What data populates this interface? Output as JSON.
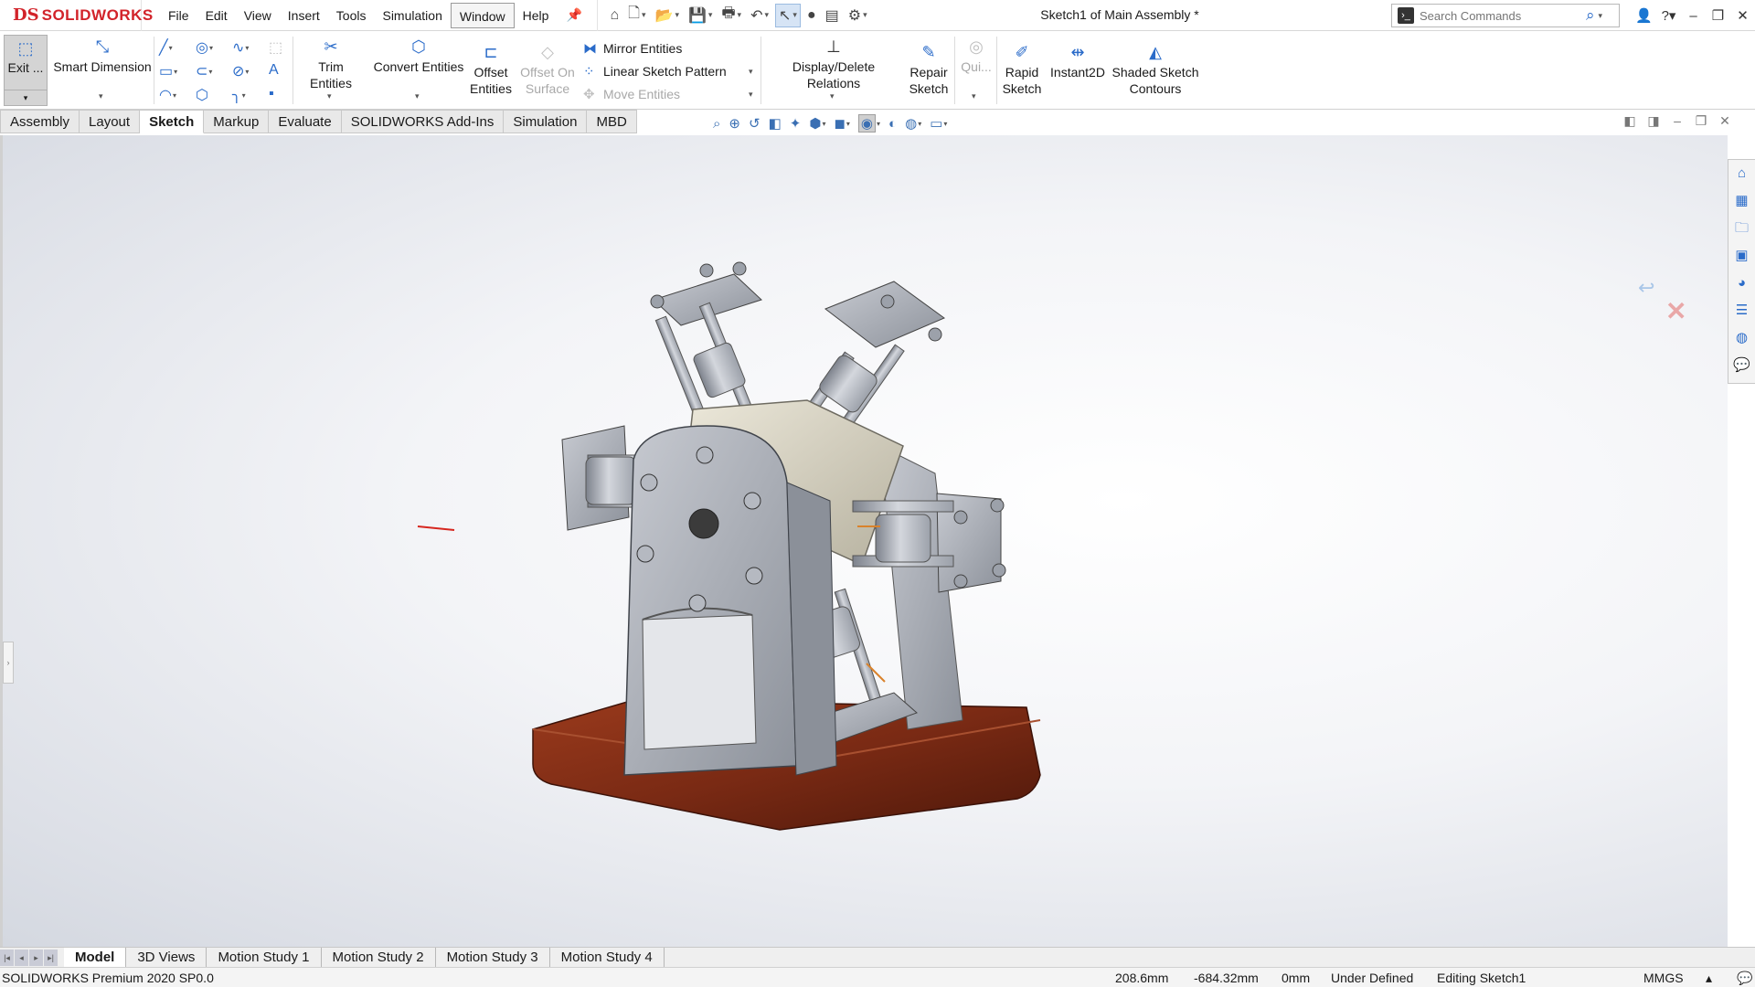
{
  "app": {
    "brand": "SOLIDWORKS",
    "brand_mark": "DS",
    "brand_color": "#d2232a",
    "document_title": "Sketch1 of Main Assembly *"
  },
  "menu": {
    "items": [
      "File",
      "Edit",
      "View",
      "Insert",
      "Tools",
      "Simulation",
      "Window",
      "Help"
    ],
    "pin_icon": "pin-icon"
  },
  "quick_access": {
    "icons": [
      "home-icon",
      "new-document-icon",
      "open-icon",
      "save-icon",
      "print-icon",
      "undo-icon",
      "select-arrow-icon",
      "traffic-light-icon",
      "file-properties-icon",
      "options-gear-icon"
    ]
  },
  "search": {
    "placeholder": "Search Commands"
  },
  "window_controls": [
    "user-icon",
    "help-icon",
    "minimize-icon",
    "restore-icon",
    "close-icon"
  ],
  "ribbon": {
    "exit_sketch": "Exit ...",
    "smart_dimension": "Smart Dimension",
    "trim_entities": "Trim Entities",
    "convert_entities": "Convert Entities",
    "offset_entities_1": "Offset",
    "offset_entities_2": "Entities",
    "offset_on_surface_1": "Offset On",
    "offset_on_surface_2": "Surface",
    "mirror_entities": "Mirror Entities",
    "linear_sketch_pattern": "Linear Sketch Pattern",
    "move_entities": "Move Entities",
    "display_delete_relations": "Display/Delete Relations",
    "repair_sketch_1": "Repair",
    "repair_sketch_2": "Sketch",
    "quick_snaps": "Qui...",
    "rapid_sketch_1": "Rapid",
    "rapid_sketch_2": "Sketch",
    "instant2d": "Instant2D",
    "shaded_sketch_1": "Shaded Sketch",
    "shaded_sketch_2": "Contours"
  },
  "tabs": {
    "items": [
      "Assembly",
      "Layout",
      "Sketch",
      "Markup",
      "Evaluate",
      "SOLIDWORKS Add-Ins",
      "Simulation",
      "MBD"
    ],
    "active": "Sketch"
  },
  "model_tabs": {
    "items": [
      "Model",
      "3D Views",
      "Motion Study 1",
      "Motion Study 2",
      "Motion Study 3",
      "Motion Study 4"
    ],
    "active": "Model"
  },
  "status": {
    "product": "SOLIDWORKS Premium 2020 SP0.0",
    "x": "208.6mm",
    "y": "-684.32mm",
    "z": "0mm",
    "sketch_state": "Under Defined",
    "editing": "Editing Sketch1",
    "units": "MMGS"
  },
  "colors": {
    "accent_blue": "#2a6bc9",
    "base_wood": "#7a2a14",
    "part_gray": "#b8bcc4"
  }
}
